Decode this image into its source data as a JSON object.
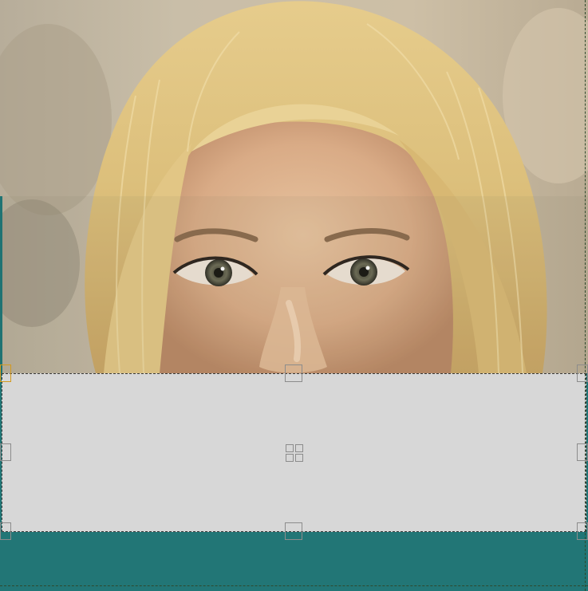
{
  "canvas": {
    "background_color": "#227676",
    "selection_fill": "#d7d7d7",
    "selection_outline": "dashed",
    "handle_color": "#8c8c8c",
    "active_handle_color": "#d49a1e"
  },
  "image": {
    "subject_icon": "portrait-photo"
  },
  "handles": [
    "top-left",
    "top-center",
    "top-right",
    "middle-left",
    "center-move",
    "middle-right",
    "bottom-left",
    "bottom-center",
    "bottom-right"
  ]
}
